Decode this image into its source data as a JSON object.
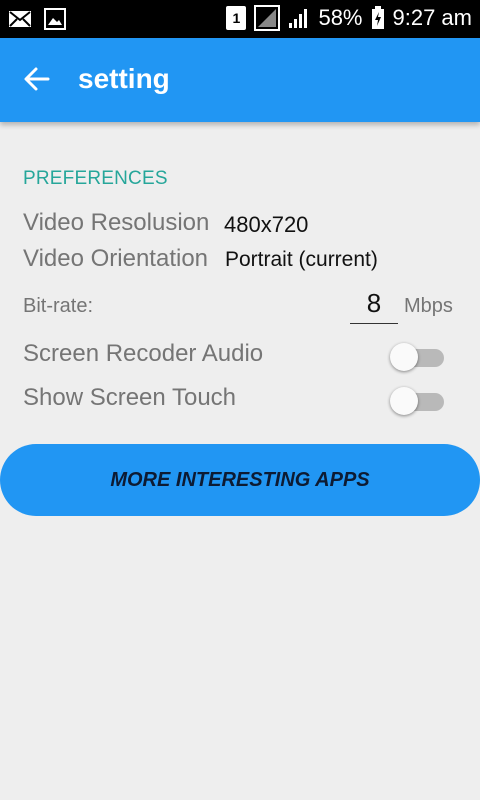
{
  "status_bar": {
    "battery": "58%",
    "time": "9:27 am",
    "sim_label": "1",
    "icons": [
      "mail-icon",
      "image-icon",
      "sim-icon",
      "signal-icon",
      "signal-bars-icon",
      "battery-charging-icon"
    ]
  },
  "app_bar": {
    "title": "setting",
    "color": "#2196f3"
  },
  "preferences": {
    "header": "PREFERENCES",
    "header_color": "#26a69a",
    "video_resolution": {
      "label": "Video Resolusion",
      "value": "480x720"
    },
    "video_orientation": {
      "label": "Video Orientation",
      "value": "Portrait (current)"
    },
    "bitrate": {
      "label": "Bit-rate:",
      "value": "8",
      "unit": "Mbps"
    },
    "screen_audio": {
      "label": "Screen Recoder Audio",
      "enabled": false
    },
    "screen_touch": {
      "label": "Show Screen Touch",
      "enabled": false
    }
  },
  "more_apps_button": {
    "label": "MORE INTERESTING APPS"
  }
}
